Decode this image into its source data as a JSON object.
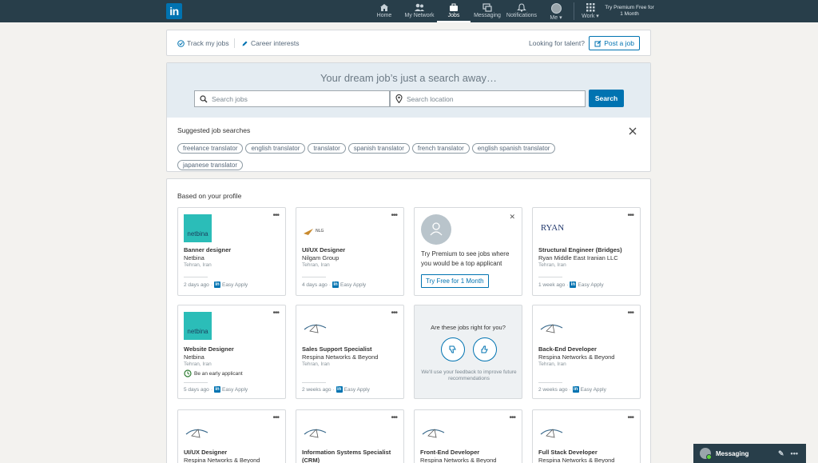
{
  "nav": {
    "logo": "in",
    "items": [
      {
        "label": "Home",
        "icon": "home-icon"
      },
      {
        "label": "My Network",
        "icon": "network-icon"
      },
      {
        "label": "Jobs",
        "icon": "briefcase-icon",
        "active": true
      },
      {
        "label": "Messaging",
        "icon": "messaging-icon"
      },
      {
        "label": "Notifications",
        "icon": "bell-icon"
      },
      {
        "label": "Me ▾",
        "icon": "avatar"
      },
      {
        "label": "Work ▾",
        "icon": "grid-icon"
      }
    ],
    "premium": "Try Premium Free for 1 Month"
  },
  "subnav": {
    "track": "Track my jobs",
    "interests": "Career interests",
    "talent": "Looking for talent?",
    "post": "Post a job"
  },
  "search": {
    "title": "Your dream job’s just a search away…",
    "jobs_placeholder": "Search jobs",
    "location_placeholder": "Search location",
    "button": "Search"
  },
  "suggested": {
    "title": "Suggested job searches",
    "items": [
      "freelance translator",
      "english translator",
      "translator",
      "spanish translator",
      "french translator",
      "english spanish translator",
      "japanese translator"
    ]
  },
  "jobs": {
    "title": "Based on your profile",
    "cards": [
      {
        "title": "Banner designer",
        "company": "Netbina",
        "location": "Tehran, Iran",
        "posted": "2 days ago",
        "apply": "Easy Apply",
        "logo": "netbina"
      },
      {
        "title": "UI/UX Designer",
        "company": "Nilgam Group",
        "location": "Tehran, Iran",
        "posted": "4 days ago",
        "apply": "Easy Apply",
        "logo": "nilgam"
      },
      {
        "title": "Structural Engineer (Bridges)",
        "company": "Ryan Middle East Iranian LLC",
        "location": "Tehran, Iran",
        "posted": "1 week ago",
        "apply": "Easy Apply",
        "logo": "ryan"
      },
      {
        "title": "Website Designer",
        "company": "Netbina",
        "location": "Tehran, Iran",
        "early": "Be an early applicant",
        "posted": "5 days ago",
        "apply": "Easy Apply",
        "logo": "netbina"
      },
      {
        "title": "Sales Support Specialist",
        "company": "Respina Networks & Beyond",
        "location": "Tehran, Iran",
        "posted": "2 weeks ago",
        "apply": "Easy Apply",
        "logo": "respina"
      },
      {
        "title": "Back-End Developer",
        "company": "Respina Networks & Beyond",
        "location": "Tehran, Iran",
        "posted": "2 weeks ago",
        "apply": "Easy Apply",
        "logo": "respina"
      },
      {
        "title": "UI/UX Designer",
        "company": "Respina Networks & Beyond",
        "logo": "respina"
      },
      {
        "title": "Information Systems Specialist (CRM)",
        "company": "",
        "logo": "respina"
      },
      {
        "title": "Front-End Developer",
        "company": "Respina Networks & Beyond",
        "logo": "respina"
      },
      {
        "title": "Full Stack Developer",
        "company": "Respina Networks & Beyond",
        "logo": "respina"
      }
    ],
    "premium_text": "Try Premium to see jobs where you would be a top applicant",
    "premium_button": "Try Free for 1 Month",
    "feedback_q": "Are these jobs right for you?",
    "feedback_note": "We'll use your feedback to improve future recommendations",
    "ryan_logo_text": "RYAN",
    "netbina_logo_text": "netbina",
    "nilgam_logo_text": "NLG"
  },
  "messaging": {
    "label": "Messaging"
  },
  "colors": {
    "nav": "#283e4a",
    "accent": "#0073b1",
    "netbina": "#2bbdb8"
  }
}
